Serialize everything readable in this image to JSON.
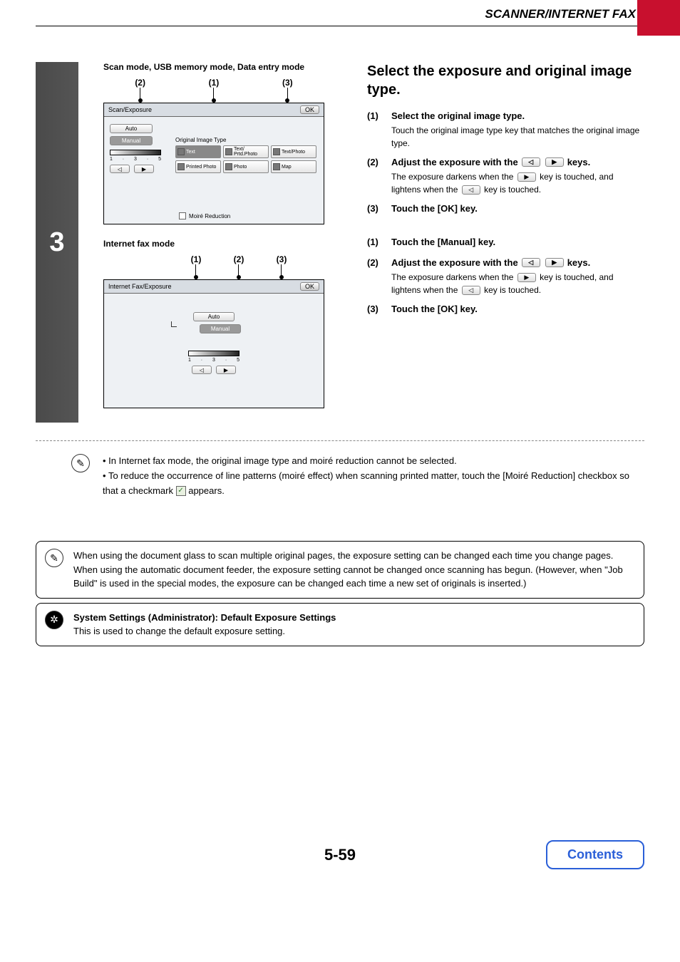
{
  "header": {
    "title": "SCANNER/INTERNET FAX"
  },
  "step": {
    "number": "3"
  },
  "left": {
    "caption1": "Scan mode, USB memory mode, Data entry mode",
    "caption2": "Internet fax mode",
    "panel1": {
      "title": "Scan/Exposure",
      "ok": "OK",
      "auto": "Auto",
      "manual": "Manual",
      "scale_lo": "1",
      "scale_mid": "3",
      "scale_hi": "5",
      "type_label": "Original Image Type",
      "btn_text": "Text",
      "btn_textprtd": "Text/ Prtd.Photo",
      "btn_textphoto": "Text/Photo",
      "btn_printed": "Printed Photo",
      "btn_photo": "Photo",
      "btn_map": "Map",
      "moire": "Moiré Reduction",
      "callout1": "(2)",
      "callout2": "(1)",
      "callout3": "(3)"
    },
    "panel2": {
      "title": "Internet Fax/Exposure",
      "ok": "OK",
      "auto": "Auto",
      "manual": "Manual",
      "scale_lo": "1",
      "scale_mid": "3",
      "scale_hi": "5",
      "callout1": "(1)",
      "callout2": "(2)",
      "callout3": "(3)"
    }
  },
  "right": {
    "heading": "Select the exposure and original image type.",
    "block1": [
      {
        "num": "(1)",
        "title": "Select the original image type.",
        "desc": "Touch the original image type key that matches the original image type."
      },
      {
        "num": "(2)",
        "title_pre": "Adjust the exposure with the ",
        "title_post": " keys.",
        "desc_a": "The exposure darkens when the ",
        "desc_b": " key is touched, and lightens when the ",
        "desc_c": " key is touched."
      },
      {
        "num": "(3)",
        "title": "Touch the [OK] key."
      }
    ],
    "block2": [
      {
        "num": "(1)",
        "title": "Touch the [Manual] key."
      },
      {
        "num": "(2)",
        "title_pre": "Adjust the exposure with the ",
        "title_post": " keys.",
        "desc_a": "The exposure darkens when the ",
        "desc_b": " key is touched, and lightens when the ",
        "desc_c": " key is touched."
      },
      {
        "num": "(3)",
        "title": "Touch the [OK] key."
      }
    ]
  },
  "notes": {
    "n1": "In Internet fax mode, the original image type and moiré reduction cannot be selected.",
    "n2_a": "To reduce the occurrence of line patterns (moiré effect) when scanning printed matter, touch the [Moiré Reduction] checkbox so that a checkmark ",
    "n2_b": " appears."
  },
  "info1": "When using the document glass to scan multiple original pages, the exposure setting can be changed each time you change pages. When using the automatic document feeder, the exposure setting cannot be changed once scanning has begun. (However, when \"Job Build\" is used in the special modes, the exposure can be changed each time a new set of originals is inserted.)",
  "info2": {
    "title": "System Settings (Administrator): Default Exposure Settings",
    "body": "This is used to change the default exposure setting."
  },
  "footer": {
    "page": "5-59",
    "contents": "Contents"
  }
}
